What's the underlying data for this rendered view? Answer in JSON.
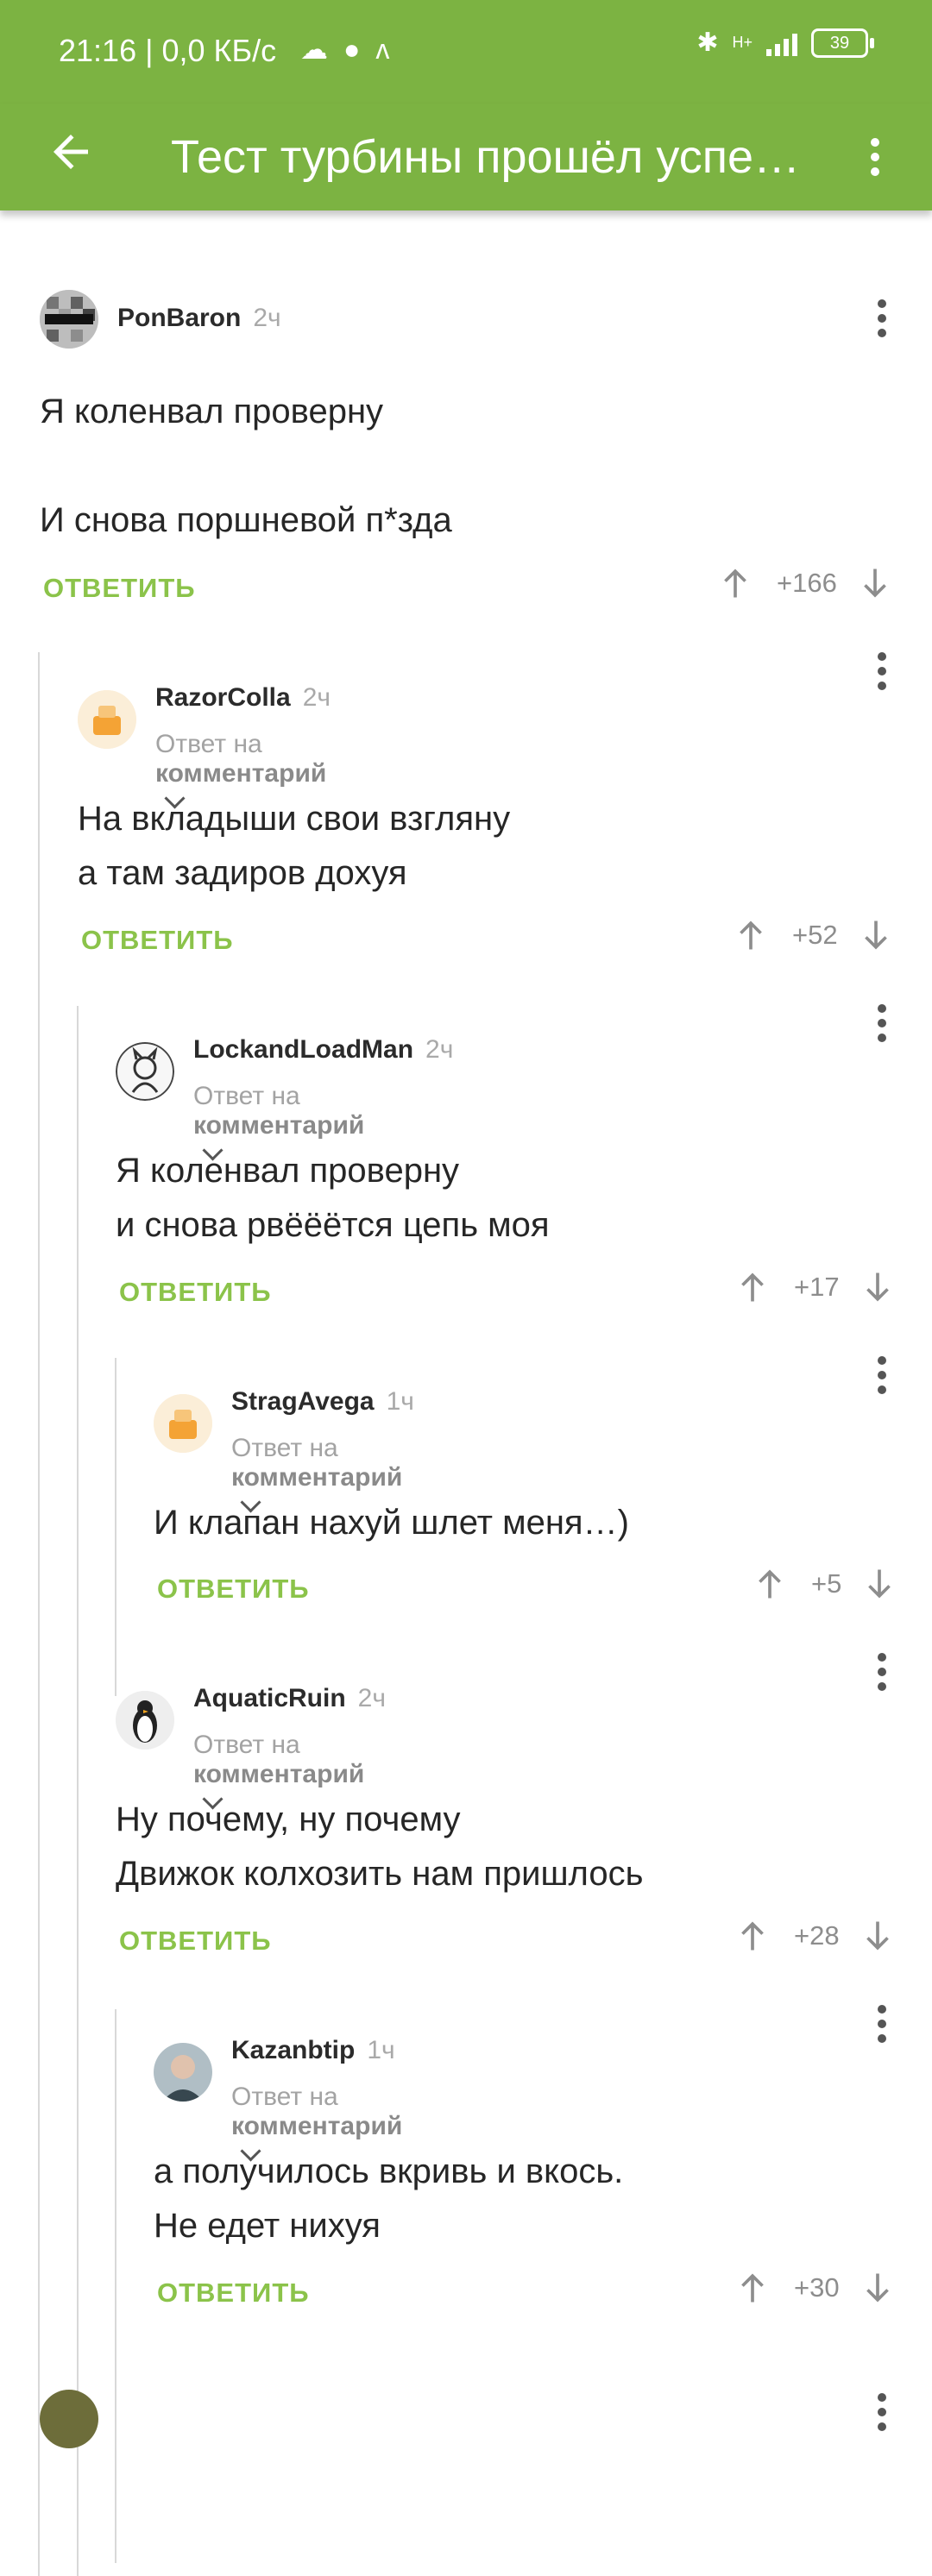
{
  "status_bar": {
    "time": "21:16 | 0,0 КБ/с",
    "icons": [
      "cloud-icon",
      "mic-icon",
      "app-icon"
    ],
    "network": "H+",
    "battery": "39"
  },
  "app_bar": {
    "title": "Тест турбины прошёл успешно",
    "back_icon": "back-arrow-icon",
    "menu_icon": "more-vert-icon"
  },
  "labels": {
    "reply": "ОТВЕТИТЬ",
    "reply_to_prefix": "Ответ на",
    "reply_to_target": "комментарий"
  },
  "comments": [
    {
      "author": "PonBaron",
      "time": "2ч",
      "text": "Я коленвал проверну\n\nИ снова поршневой п*зда",
      "rating": "+166",
      "is_reply": false
    },
    {
      "author": "RazorColla",
      "time": "2ч",
      "text": "На вкладыши свои взгляну\nа там задиров дохуя",
      "rating": "+52",
      "is_reply": true
    },
    {
      "author": "LockandLoadMan",
      "time": "2ч",
      "text": "Я коленвал проверну\nи снова рвёёётся цепь моя",
      "rating": "+17",
      "is_reply": true
    },
    {
      "author": "StragAvega",
      "time": "1ч",
      "text": "И клапан нахуй шлет меня…)",
      "rating": "+5",
      "is_reply": true
    },
    {
      "author": "AquaticRuin",
      "time": "2ч",
      "text": "Ну почему, ну почему\nДвижок колхозить нам пришлось",
      "rating": "+28",
      "is_reply": true
    },
    {
      "author": "Kazanbtip",
      "time": "1ч",
      "text": "а получилось вкривь и вкось.\nНе едет нихуя",
      "rating": "+30",
      "is_reply": true
    }
  ]
}
